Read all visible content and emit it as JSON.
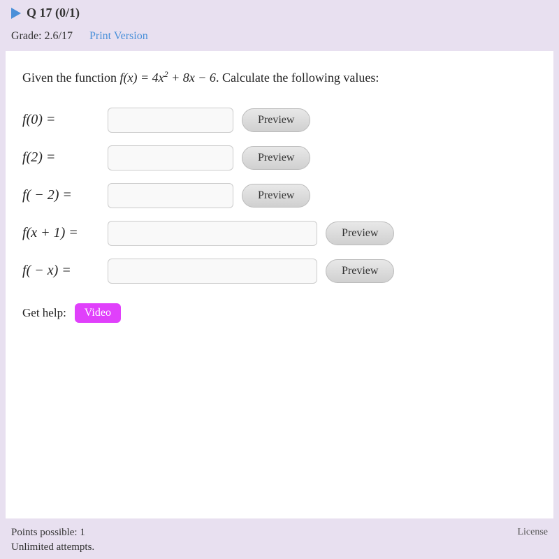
{
  "topbar": {
    "q_label": "Q 17 (0/1)"
  },
  "grade_bar": {
    "grade_label": "Grade: 2.6/17",
    "print_label": "Print Version"
  },
  "problem": {
    "description_pre": "Given the function ",
    "function_display": "f(x) = 4x² + 8x − 6. Calculate the following values:",
    "rows": [
      {
        "label": "f(0) =",
        "placeholder": "",
        "input_size": "short",
        "preview_label": "Preview"
      },
      {
        "label": "f(2) =",
        "placeholder": "",
        "input_size": "short",
        "preview_label": "Preview"
      },
      {
        "label": "f( − 2) =",
        "placeholder": "",
        "input_size": "short",
        "preview_label": "Preview"
      },
      {
        "label": "f(x + 1) =",
        "placeholder": "",
        "input_size": "long",
        "preview_label": "Preview"
      },
      {
        "label": "f( − x) =",
        "placeholder": "",
        "input_size": "long",
        "preview_label": "Preview"
      }
    ]
  },
  "help": {
    "label": "Get help:",
    "video_label": "Video"
  },
  "footer": {
    "points_label": "Points possible: 1",
    "attempts_label": "Unlimited attempts.",
    "license_label": "License"
  }
}
